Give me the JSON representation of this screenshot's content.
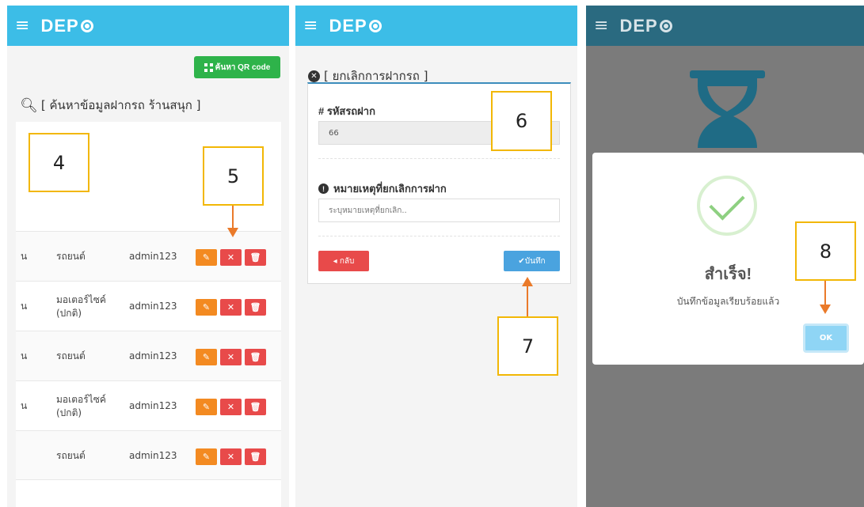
{
  "app": {
    "logo": "DEP"
  },
  "panel1": {
    "qr_button": "ค้นหา QR code",
    "search_title": "[ ค้นหาข้อมูลฝากรถ ร้านสนุก ]",
    "rows": [
      {
        "left": "น",
        "vehicle": "รถยนต์",
        "user": "admin123"
      },
      {
        "left": "น",
        "vehicle": "มอเตอร์ไซค์ (ปกติ)",
        "user": "admin123"
      },
      {
        "left": "น",
        "vehicle": "รถยนต์",
        "user": "admin123"
      },
      {
        "left": "น",
        "vehicle": "มอเตอร์ไซค์ (ปกติ)",
        "user": "admin123"
      },
      {
        "left": "",
        "vehicle": "รถยนต์",
        "user": "admin123"
      }
    ]
  },
  "panel2": {
    "title": "[ ยกเลิกการฝากรถ ]",
    "code_label": "# รหัสรถฝาก",
    "code_value": "66",
    "reason_label": "หมายเหตุที่ยกเลิกการฝาก",
    "reason_placeholder": "ระบุหมายเหตุที่ยกเลิก..",
    "back_label": "◂ กลับ",
    "save_label": "✔บันทึก"
  },
  "panel3": {
    "dialog_title": "สำเร็จ!",
    "dialog_text": "บันทึกข้อมูลเรียบร้อยแล้ว",
    "ok_label": "OK"
  },
  "annotations": {
    "a4": "4",
    "a5": "5",
    "a6": "6",
    "a7": "7",
    "a8": "8"
  }
}
